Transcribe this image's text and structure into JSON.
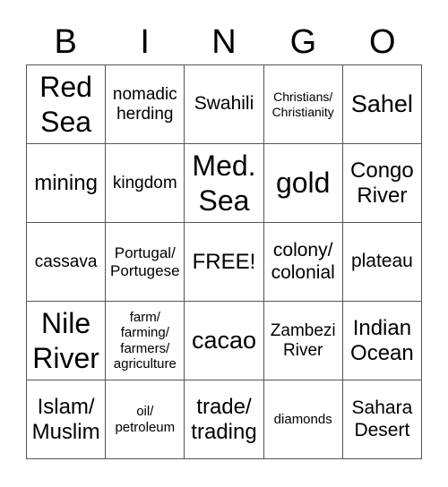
{
  "header": {
    "letters": [
      "B",
      "I",
      "N",
      "G",
      "O"
    ]
  },
  "cells": [
    [
      "Red\nSea",
      "nomadic\nherding",
      "Swahili",
      "Christians/\nChristianity",
      "Sahel"
    ],
    [
      "mining",
      "kingdom",
      "Med.\nSea",
      "gold",
      "Congo\nRiver"
    ],
    [
      "cassava",
      "Portugal/\nPortugese",
      "FREE!",
      "colony/\ncolonial",
      "plateau"
    ],
    [
      "Nile\nRiver",
      "farm/\nfarming/\nfarmers/\nagriculture",
      "cacao",
      "Zambezi\nRiver",
      "Indian\nOcean"
    ],
    [
      "Islam/\nMuslim",
      "oil/\npetroleum",
      "trade/\ntrading",
      "diamonds",
      "Sahara\nDesert"
    ]
  ]
}
